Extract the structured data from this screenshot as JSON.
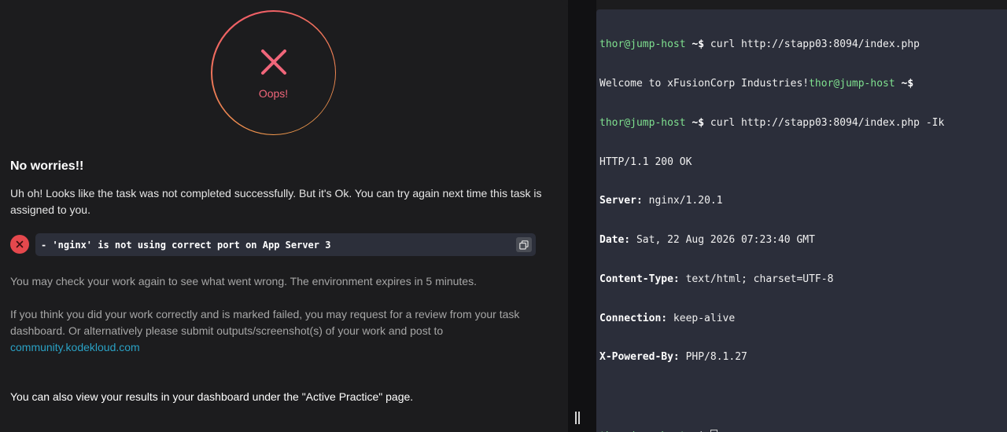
{
  "result": {
    "status_text": "Oops!",
    "title": "No worries!!",
    "lead": "Uh oh! Looks like the task was not completed successfully. But it's Ok. You can try again next time this task is assigned to you.",
    "error_message": "- 'nginx' is not using correct port on App Server 3",
    "check_text": "You may check your work again to see what went wrong. The environment expires in 5 minutes.",
    "review_text": "If you think you did your work correctly and is marked failed, you may request for a review from your task dashboard. Or alternatively please submit outputs/screenshot(s) of your work and post to",
    "community_link": "community.kodekloud.com",
    "dashboard_text": "You can also view your results in your dashboard under the \"Active Practice\" page."
  },
  "terminal": {
    "prompt": "thor@jump-host ~$",
    "cmd1": " curl http://stapp03:8094/index.php",
    "output1": "Welcome to xFusionCorp Industries!",
    "cmd2": " curl http://stapp03:8094/index.php -Ik",
    "status_line": "HTTP/1.1 200 OK",
    "headers": [
      {
        "key": "Server:",
        "value": " nginx/1.20.1"
      },
      {
        "key": "Date:",
        "value": " Sat, 22 Aug 2026 07:23:40 GMT"
      },
      {
        "key": "Content-Type:",
        "value": " text/html; charset=UTF-8"
      },
      {
        "key": "Connection:",
        "value": " keep-alive"
      },
      {
        "key": "X-Powered-By:",
        "value": " PHP/8.1.27"
      }
    ]
  },
  "colors": {
    "accent_error": "#e5484d",
    "prompt_green": "#7fe08f",
    "link": "#2aa1c4"
  }
}
